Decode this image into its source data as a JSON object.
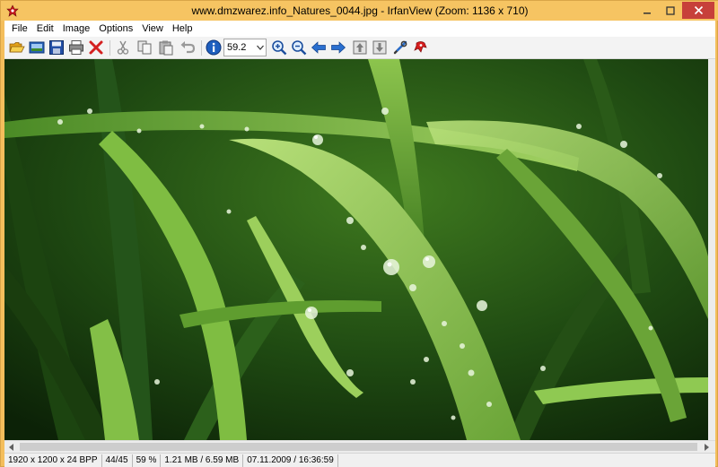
{
  "window": {
    "title": "www.dmzwarez.info_Natures_0044.jpg - IrfanView (Zoom: 1136 x 710)",
    "accent_color": "#f6c462",
    "close_color": "#c7403a"
  },
  "menu": {
    "items": [
      "File",
      "Edit",
      "Image",
      "Options",
      "View",
      "Help"
    ]
  },
  "toolbar": {
    "zoom_value": "59.2",
    "buttons": [
      "open-folder-icon",
      "thumbnails-icon",
      "save-icon",
      "print-icon",
      "delete-icon",
      "cut-icon",
      "copy-icon",
      "paste-icon",
      "undo-icon",
      "info-icon",
      "zoom-in-icon",
      "zoom-out-icon",
      "previous-icon",
      "next-icon",
      "first-icon",
      "last-icon",
      "settings-icon",
      "about-icon"
    ]
  },
  "status": {
    "dimensions": "1920 x 1200 x 24 BPP",
    "index": "44/45",
    "zoom": "59 %",
    "size": "1.21 MB / 6.59 MB",
    "date": "07.11.2009 / 16:36:59"
  }
}
